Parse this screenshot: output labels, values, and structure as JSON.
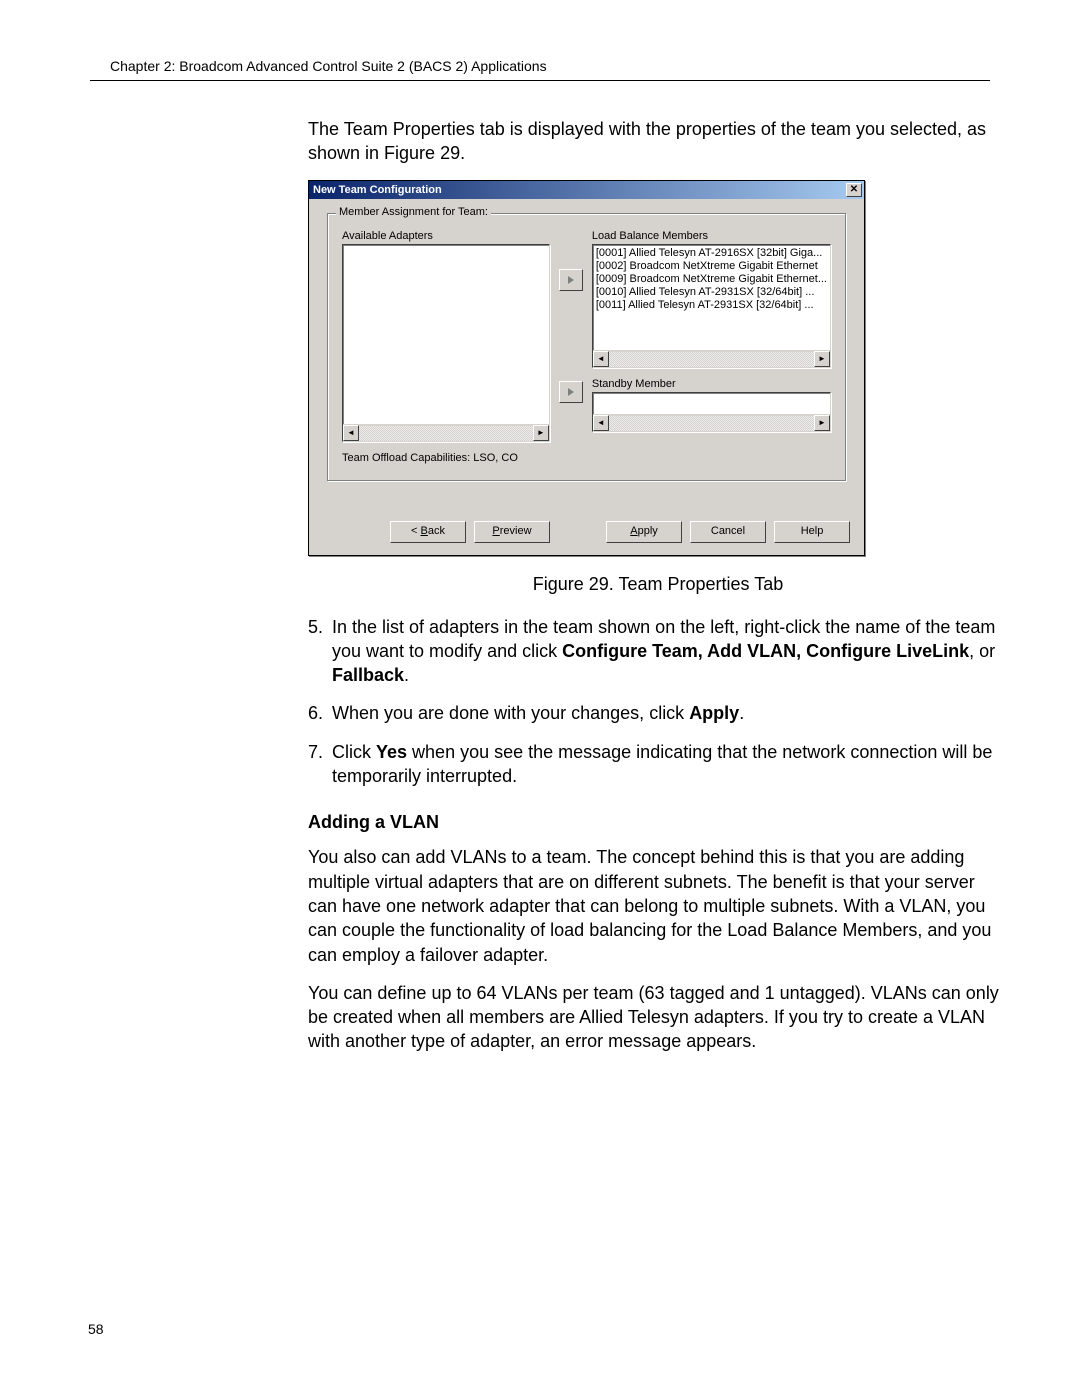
{
  "page": {
    "chapter_header": "Chapter 2: Broadcom Advanced Control Suite 2 (BACS 2) Applications",
    "page_number": "58"
  },
  "intro": "The Team Properties tab is displayed with the properties of the team you selected, as shown in Figure 29.",
  "dialog": {
    "title": "New Team Configuration",
    "close_glyph": "✕",
    "groupbox_label": "Member Assignment for Team:",
    "available_label": "Available Adapters",
    "lbm_label": "Load Balance Members",
    "standby_label": "Standby Member",
    "lbm_items": [
      "[0001] Allied Telesyn AT-2916SX [32bit] Giga...",
      "[0002] Broadcom NetXtreme Gigabit Ethernet",
      "[0009] Broadcom NetXtreme Gigabit Ethernet...",
      "[0010] Allied Telesyn AT-2931SX [32/64bit] ...",
      "[0011] Allied Telesyn AT-2931SX [32/64bit] ..."
    ],
    "offload_text": "Team Offload Capabilities:  LSO, CO",
    "buttons": {
      "back_pre": "< ",
      "back_u": "B",
      "back_post": "ack",
      "preview_u": "P",
      "preview_post": "review",
      "apply_u": "A",
      "apply_post": "pply",
      "cancel": "Cancel",
      "help": "Help"
    }
  },
  "figure_caption": "Figure 29. Team Properties Tab",
  "step5": {
    "num": "5.",
    "part1": "In the list of adapters in the team shown on the left, right-click the name of the team you want to modify and click ",
    "bold1": "Configure Team, Add VLAN, Configure LiveLink",
    "mid": ", or ",
    "bold2": "Fallback",
    "end": "."
  },
  "step6": {
    "num": "6.",
    "part1": "When you are done with your changes, click ",
    "bold1": "Apply",
    "end": "."
  },
  "step7": {
    "num": "7.",
    "part1": "Click ",
    "bold1": "Yes",
    "part2": " when you see the message indicating that the network connection will be temporarily interrupted."
  },
  "vlan": {
    "heading": "Adding a VLAN",
    "p1": "You also can add VLANs to a team. The concept behind this is that you are adding multiple virtual adapters that are on different subnets. The benefit is that your server can have one network adapter that can belong to multiple subnets. With a VLAN, you can couple the functionality of load balancing for the Load Balance Members, and you can employ a failover adapter.",
    "p2": "You can define up to 64 VLANs per team (63 tagged and 1 untagged). VLANs can only be created when all members are Allied Telesyn adapters. If you try to create a VLAN with another type of adapter, an error message appears."
  }
}
